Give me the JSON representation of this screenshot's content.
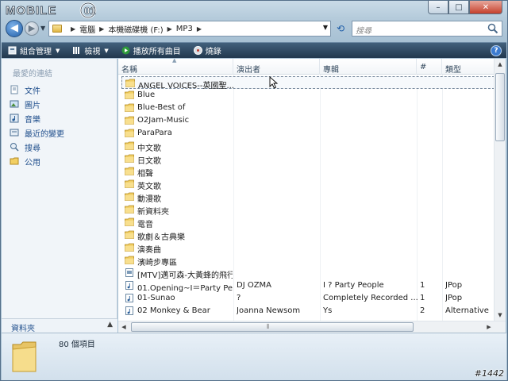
{
  "window": {
    "watermark_logo": "MOBILE01",
    "buttons": {
      "minimize": "–",
      "maximize": "□",
      "close": "✕"
    }
  },
  "nav": {
    "back": "◀",
    "forward": "▶",
    "breadcrumb": [
      "電腦",
      "本機磁碟機 (F:)",
      "MP3"
    ],
    "search_placeholder": "搜尋"
  },
  "toolbar": {
    "organize": "組合管理",
    "views": "檢視",
    "play_all": "播放所有曲目",
    "burn": "燒錄",
    "help": "?"
  },
  "navpane": {
    "title": "最愛的連結",
    "items": [
      {
        "label": "文件",
        "icon": "documents-icon"
      },
      {
        "label": "圖片",
        "icon": "pictures-icon"
      },
      {
        "label": "音樂",
        "icon": "music-icon"
      },
      {
        "label": "最近的變更",
        "icon": "recent-icon"
      },
      {
        "label": "搜尋",
        "icon": "search-icon"
      },
      {
        "label": "公用",
        "icon": "public-folder-icon"
      }
    ],
    "folders_label": "資料夾"
  },
  "columns": {
    "name": "名稱",
    "artist": "演出者",
    "album": "專輯",
    "track": "#",
    "genre": "類型"
  },
  "rows": [
    {
      "type": "folder",
      "name": "ANGEL VOICES--英國聖...",
      "artist": "",
      "album": "",
      "track": "",
      "genre": "",
      "selected": true
    },
    {
      "type": "folder",
      "name": "Blue",
      "artist": "",
      "album": "",
      "track": "",
      "genre": ""
    },
    {
      "type": "folder",
      "name": "Blue-Best of",
      "artist": "",
      "album": "",
      "track": "",
      "genre": ""
    },
    {
      "type": "folder",
      "name": "O2Jam-Music",
      "artist": "",
      "album": "",
      "track": "",
      "genre": ""
    },
    {
      "type": "folder",
      "name": "ParaPara",
      "artist": "",
      "album": "",
      "track": "",
      "genre": ""
    },
    {
      "type": "folder",
      "name": "中文歌",
      "artist": "",
      "album": "",
      "track": "",
      "genre": ""
    },
    {
      "type": "folder",
      "name": "日文歌",
      "artist": "",
      "album": "",
      "track": "",
      "genre": ""
    },
    {
      "type": "folder",
      "name": "相聲",
      "artist": "",
      "album": "",
      "track": "",
      "genre": ""
    },
    {
      "type": "folder",
      "name": "英文歌",
      "artist": "",
      "album": "",
      "track": "",
      "genre": ""
    },
    {
      "type": "folder",
      "name": "動漫歌",
      "artist": "",
      "album": "",
      "track": "",
      "genre": ""
    },
    {
      "type": "folder",
      "name": "新資料夾",
      "artist": "",
      "album": "",
      "track": "",
      "genre": ""
    },
    {
      "type": "folder",
      "name": "電音",
      "artist": "",
      "album": "",
      "track": "",
      "genre": ""
    },
    {
      "type": "folder",
      "name": "歌劇＆古典樂",
      "artist": "",
      "album": "",
      "track": "",
      "genre": ""
    },
    {
      "type": "folder",
      "name": "演奏曲",
      "artist": "",
      "album": "",
      "track": "",
      "genre": ""
    },
    {
      "type": "folder",
      "name": "濱崎步專區",
      "artist": "",
      "album": "",
      "track": "",
      "genre": ""
    },
    {
      "type": "file",
      "name": "[MTV]邁可森-大黃蜂的飛行",
      "artist": "",
      "album": "",
      "track": "",
      "genre": ""
    },
    {
      "type": "music",
      "name": "01.Opening~I＝Party Pe...",
      "artist": "DJ OZMA",
      "album": "I ? Party People",
      "track": "1",
      "genre": "JPop"
    },
    {
      "type": "music",
      "name": "01-Sunao",
      "artist": "?",
      "album": "Completely Recorded ...",
      "track": "1",
      "genre": "JPop"
    },
    {
      "type": "music",
      "name": "02 Monkey & Bear",
      "artist": "Joanna Newsom",
      "album": "Ys",
      "track": "2",
      "genre": "Alternative"
    }
  ],
  "details": {
    "item_count": "80 個項目"
  },
  "watermark_tag": "#1442"
}
